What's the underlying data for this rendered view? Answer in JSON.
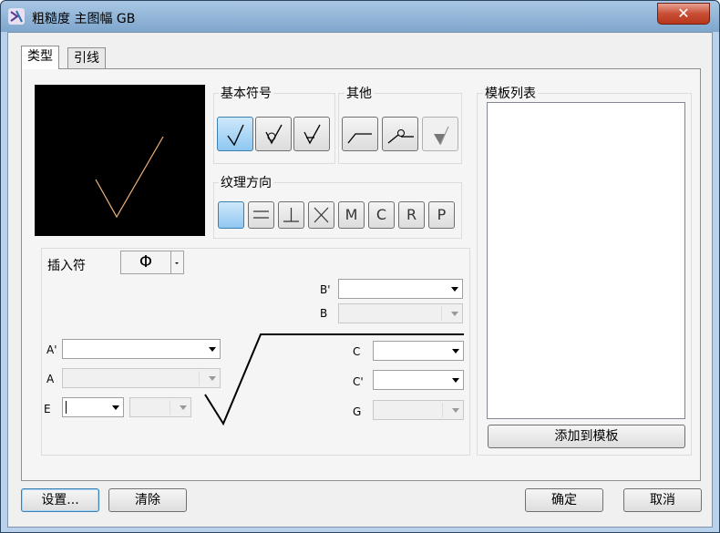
{
  "window": {
    "title": "粗糙度 主图幅 GB",
    "close_label": "✕"
  },
  "tabs": [
    {
      "label": "类型"
    },
    {
      "label": "引线"
    }
  ],
  "groups": {
    "basic_symbols": "基本符号",
    "other": "其他",
    "texture_direction": "纹理方向",
    "template_list": "模板列表"
  },
  "texture_buttons": [
    "",
    "",
    "",
    "",
    "M",
    "C",
    "R",
    "P"
  ],
  "insert": {
    "label": "插入符",
    "symbol": "Φ"
  },
  "fields": {
    "b_prime": "B'",
    "b": "B",
    "a_prime": "A'",
    "a": "A",
    "e": "E",
    "c": "C",
    "c_prime": "C'",
    "g": "G"
  },
  "buttons": {
    "add_to_template": "添加到模板",
    "settings": "设置...",
    "clear": "清除",
    "ok": "确定",
    "cancel": "取消"
  }
}
